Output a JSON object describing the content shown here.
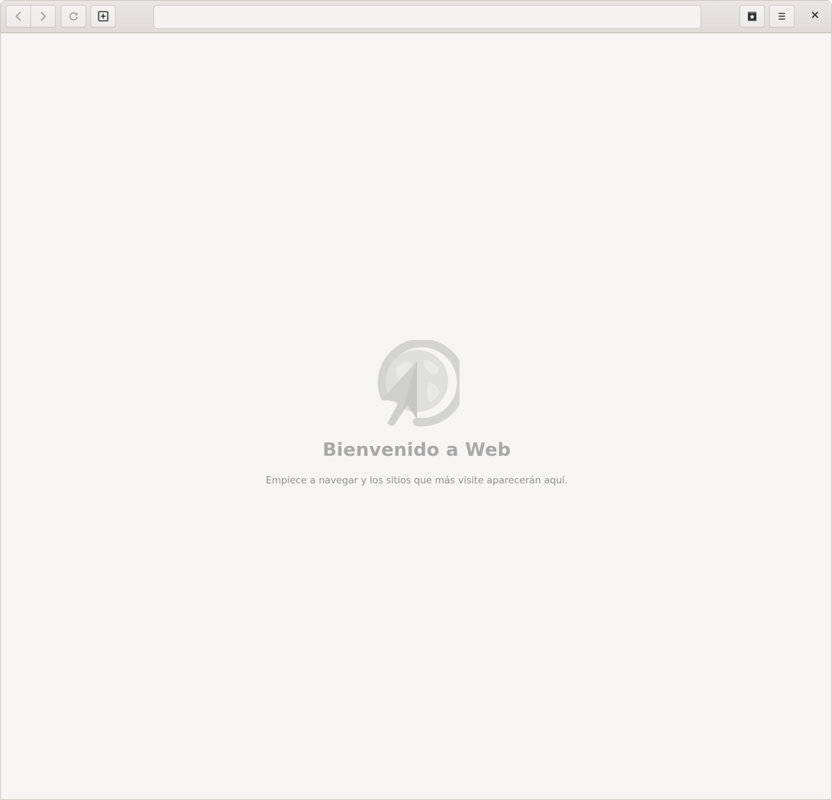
{
  "toolbar": {
    "back_icon": "chevron-left-icon",
    "forward_icon": "chevron-right-icon",
    "reload_icon": "reload-icon",
    "new_tab_icon": "new-tab-icon",
    "bookmarks_icon": "bookmark-star-icon",
    "menu_icon": "hamburger-menu-icon",
    "close_icon": "close-icon"
  },
  "address_bar": {
    "value": "",
    "placeholder": ""
  },
  "overview": {
    "logo_icon": "epiphany-web-logo-icon",
    "title": "Bienvenido a Web",
    "subtitle": "Empiece a navegar y los sitios que más visite aparecerán aquí."
  },
  "colors": {
    "window_bg": "#f6f5f4",
    "headerbar_bg": "#e8e6e3",
    "logo_gray": "#d3d3d2",
    "title_gray": "#a8a8a8",
    "subtitle_gray": "#8f8f8f"
  }
}
